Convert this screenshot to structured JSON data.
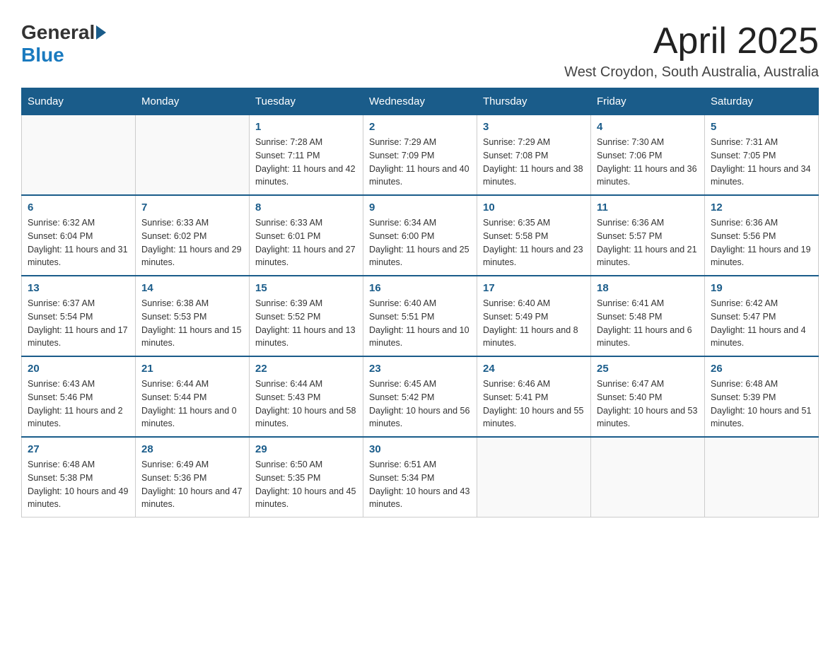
{
  "header": {
    "logo_general": "General",
    "logo_blue": "Blue",
    "month_title": "April 2025",
    "location": "West Croydon, South Australia, Australia"
  },
  "weekdays": [
    "Sunday",
    "Monday",
    "Tuesday",
    "Wednesday",
    "Thursday",
    "Friday",
    "Saturday"
  ],
  "weeks": [
    [
      {
        "day": "",
        "sunrise": "",
        "sunset": "",
        "daylight": ""
      },
      {
        "day": "",
        "sunrise": "",
        "sunset": "",
        "daylight": ""
      },
      {
        "day": "1",
        "sunrise": "Sunrise: 7:28 AM",
        "sunset": "Sunset: 7:11 PM",
        "daylight": "Daylight: 11 hours and 42 minutes."
      },
      {
        "day": "2",
        "sunrise": "Sunrise: 7:29 AM",
        "sunset": "Sunset: 7:09 PM",
        "daylight": "Daylight: 11 hours and 40 minutes."
      },
      {
        "day": "3",
        "sunrise": "Sunrise: 7:29 AM",
        "sunset": "Sunset: 7:08 PM",
        "daylight": "Daylight: 11 hours and 38 minutes."
      },
      {
        "day": "4",
        "sunrise": "Sunrise: 7:30 AM",
        "sunset": "Sunset: 7:06 PM",
        "daylight": "Daylight: 11 hours and 36 minutes."
      },
      {
        "day": "5",
        "sunrise": "Sunrise: 7:31 AM",
        "sunset": "Sunset: 7:05 PM",
        "daylight": "Daylight: 11 hours and 34 minutes."
      }
    ],
    [
      {
        "day": "6",
        "sunrise": "Sunrise: 6:32 AM",
        "sunset": "Sunset: 6:04 PM",
        "daylight": "Daylight: 11 hours and 31 minutes."
      },
      {
        "day": "7",
        "sunrise": "Sunrise: 6:33 AM",
        "sunset": "Sunset: 6:02 PM",
        "daylight": "Daylight: 11 hours and 29 minutes."
      },
      {
        "day": "8",
        "sunrise": "Sunrise: 6:33 AM",
        "sunset": "Sunset: 6:01 PM",
        "daylight": "Daylight: 11 hours and 27 minutes."
      },
      {
        "day": "9",
        "sunrise": "Sunrise: 6:34 AM",
        "sunset": "Sunset: 6:00 PM",
        "daylight": "Daylight: 11 hours and 25 minutes."
      },
      {
        "day": "10",
        "sunrise": "Sunrise: 6:35 AM",
        "sunset": "Sunset: 5:58 PM",
        "daylight": "Daylight: 11 hours and 23 minutes."
      },
      {
        "day": "11",
        "sunrise": "Sunrise: 6:36 AM",
        "sunset": "Sunset: 5:57 PM",
        "daylight": "Daylight: 11 hours and 21 minutes."
      },
      {
        "day": "12",
        "sunrise": "Sunrise: 6:36 AM",
        "sunset": "Sunset: 5:56 PM",
        "daylight": "Daylight: 11 hours and 19 minutes."
      }
    ],
    [
      {
        "day": "13",
        "sunrise": "Sunrise: 6:37 AM",
        "sunset": "Sunset: 5:54 PM",
        "daylight": "Daylight: 11 hours and 17 minutes."
      },
      {
        "day": "14",
        "sunrise": "Sunrise: 6:38 AM",
        "sunset": "Sunset: 5:53 PM",
        "daylight": "Daylight: 11 hours and 15 minutes."
      },
      {
        "day": "15",
        "sunrise": "Sunrise: 6:39 AM",
        "sunset": "Sunset: 5:52 PM",
        "daylight": "Daylight: 11 hours and 13 minutes."
      },
      {
        "day": "16",
        "sunrise": "Sunrise: 6:40 AM",
        "sunset": "Sunset: 5:51 PM",
        "daylight": "Daylight: 11 hours and 10 minutes."
      },
      {
        "day": "17",
        "sunrise": "Sunrise: 6:40 AM",
        "sunset": "Sunset: 5:49 PM",
        "daylight": "Daylight: 11 hours and 8 minutes."
      },
      {
        "day": "18",
        "sunrise": "Sunrise: 6:41 AM",
        "sunset": "Sunset: 5:48 PM",
        "daylight": "Daylight: 11 hours and 6 minutes."
      },
      {
        "day": "19",
        "sunrise": "Sunrise: 6:42 AM",
        "sunset": "Sunset: 5:47 PM",
        "daylight": "Daylight: 11 hours and 4 minutes."
      }
    ],
    [
      {
        "day": "20",
        "sunrise": "Sunrise: 6:43 AM",
        "sunset": "Sunset: 5:46 PM",
        "daylight": "Daylight: 11 hours and 2 minutes."
      },
      {
        "day": "21",
        "sunrise": "Sunrise: 6:44 AM",
        "sunset": "Sunset: 5:44 PM",
        "daylight": "Daylight: 11 hours and 0 minutes."
      },
      {
        "day": "22",
        "sunrise": "Sunrise: 6:44 AM",
        "sunset": "Sunset: 5:43 PM",
        "daylight": "Daylight: 10 hours and 58 minutes."
      },
      {
        "day": "23",
        "sunrise": "Sunrise: 6:45 AM",
        "sunset": "Sunset: 5:42 PM",
        "daylight": "Daylight: 10 hours and 56 minutes."
      },
      {
        "day": "24",
        "sunrise": "Sunrise: 6:46 AM",
        "sunset": "Sunset: 5:41 PM",
        "daylight": "Daylight: 10 hours and 55 minutes."
      },
      {
        "day": "25",
        "sunrise": "Sunrise: 6:47 AM",
        "sunset": "Sunset: 5:40 PM",
        "daylight": "Daylight: 10 hours and 53 minutes."
      },
      {
        "day": "26",
        "sunrise": "Sunrise: 6:48 AM",
        "sunset": "Sunset: 5:39 PM",
        "daylight": "Daylight: 10 hours and 51 minutes."
      }
    ],
    [
      {
        "day": "27",
        "sunrise": "Sunrise: 6:48 AM",
        "sunset": "Sunset: 5:38 PM",
        "daylight": "Daylight: 10 hours and 49 minutes."
      },
      {
        "day": "28",
        "sunrise": "Sunrise: 6:49 AM",
        "sunset": "Sunset: 5:36 PM",
        "daylight": "Daylight: 10 hours and 47 minutes."
      },
      {
        "day": "29",
        "sunrise": "Sunrise: 6:50 AM",
        "sunset": "Sunset: 5:35 PM",
        "daylight": "Daylight: 10 hours and 45 minutes."
      },
      {
        "day": "30",
        "sunrise": "Sunrise: 6:51 AM",
        "sunset": "Sunset: 5:34 PM",
        "daylight": "Daylight: 10 hours and 43 minutes."
      },
      {
        "day": "",
        "sunrise": "",
        "sunset": "",
        "daylight": ""
      },
      {
        "day": "",
        "sunrise": "",
        "sunset": "",
        "daylight": ""
      },
      {
        "day": "",
        "sunrise": "",
        "sunset": "",
        "daylight": ""
      }
    ]
  ]
}
